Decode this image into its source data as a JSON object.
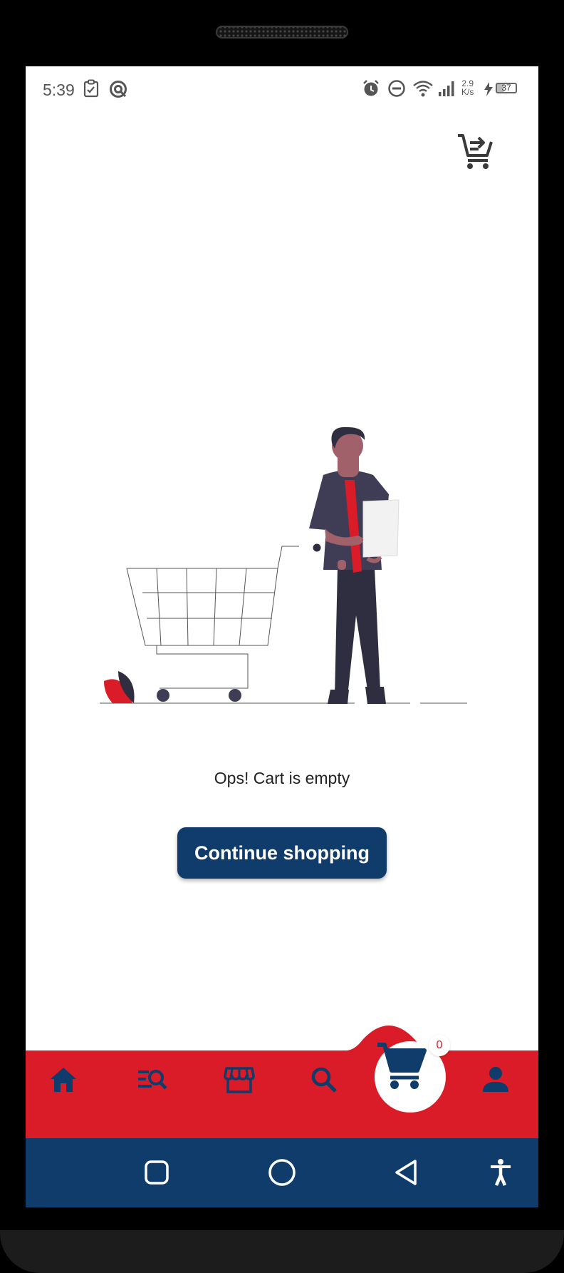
{
  "status_bar": {
    "time": "5:39",
    "network_speed_value": "2.9",
    "network_speed_unit": "K/s",
    "battery_level": "37",
    "icons": [
      "clipboard-check-icon",
      "sync-icon",
      "alarm-icon",
      "do-not-disturb-icon",
      "wifi-icon",
      "signal-icon",
      "charging-icon",
      "battery-icon"
    ]
  },
  "header": {
    "cart_icon": "add-to-cart-icon"
  },
  "main": {
    "illustration": "empty-cart-illustration",
    "empty_message": "Ops! Cart is empty",
    "continue_button_label": "Continue shopping"
  },
  "bottom_nav": {
    "items": [
      {
        "name": "home",
        "icon": "home-icon"
      },
      {
        "name": "search-list",
        "icon": "list-search-icon"
      },
      {
        "name": "stores",
        "icon": "store-icon"
      },
      {
        "name": "search",
        "icon": "search-icon"
      },
      {
        "name": "cart",
        "icon": "cart-icon",
        "badge": "0"
      },
      {
        "name": "profile",
        "icon": "person-icon"
      }
    ]
  },
  "system_nav": {
    "icons": [
      "recents-icon",
      "home-circle-icon",
      "back-icon",
      "accessibility-icon"
    ]
  },
  "colors": {
    "primary_navy": "#0f3c6a",
    "accent_red": "#d91c27",
    "background": "#ffffff"
  }
}
